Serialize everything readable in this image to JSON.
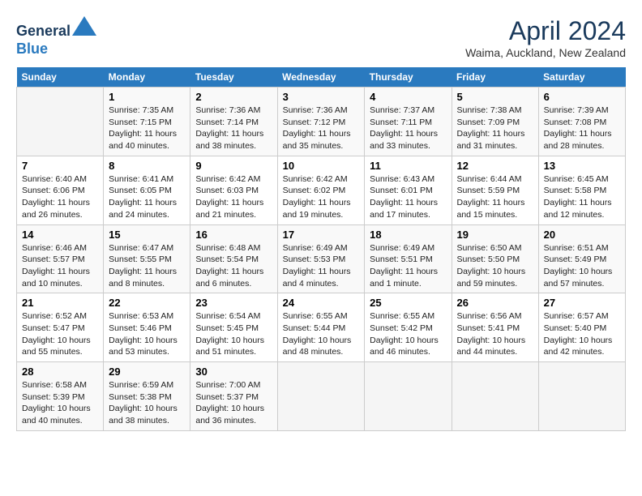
{
  "header": {
    "logo_line1": "General",
    "logo_line2": "Blue",
    "month": "April 2024",
    "location": "Waima, Auckland, New Zealand"
  },
  "weekdays": [
    "Sunday",
    "Monday",
    "Tuesday",
    "Wednesday",
    "Thursday",
    "Friday",
    "Saturday"
  ],
  "weeks": [
    [
      {
        "day": "",
        "info": ""
      },
      {
        "day": "1",
        "info": "Sunrise: 7:35 AM\nSunset: 7:15 PM\nDaylight: 11 hours\nand 40 minutes."
      },
      {
        "day": "2",
        "info": "Sunrise: 7:36 AM\nSunset: 7:14 PM\nDaylight: 11 hours\nand 38 minutes."
      },
      {
        "day": "3",
        "info": "Sunrise: 7:36 AM\nSunset: 7:12 PM\nDaylight: 11 hours\nand 35 minutes."
      },
      {
        "day": "4",
        "info": "Sunrise: 7:37 AM\nSunset: 7:11 PM\nDaylight: 11 hours\nand 33 minutes."
      },
      {
        "day": "5",
        "info": "Sunrise: 7:38 AM\nSunset: 7:09 PM\nDaylight: 11 hours\nand 31 minutes."
      },
      {
        "day": "6",
        "info": "Sunrise: 7:39 AM\nSunset: 7:08 PM\nDaylight: 11 hours\nand 28 minutes."
      }
    ],
    [
      {
        "day": "7",
        "info": "Sunrise: 6:40 AM\nSunset: 6:06 PM\nDaylight: 11 hours\nand 26 minutes."
      },
      {
        "day": "8",
        "info": "Sunrise: 6:41 AM\nSunset: 6:05 PM\nDaylight: 11 hours\nand 24 minutes."
      },
      {
        "day": "9",
        "info": "Sunrise: 6:42 AM\nSunset: 6:03 PM\nDaylight: 11 hours\nand 21 minutes."
      },
      {
        "day": "10",
        "info": "Sunrise: 6:42 AM\nSunset: 6:02 PM\nDaylight: 11 hours\nand 19 minutes."
      },
      {
        "day": "11",
        "info": "Sunrise: 6:43 AM\nSunset: 6:01 PM\nDaylight: 11 hours\nand 17 minutes."
      },
      {
        "day": "12",
        "info": "Sunrise: 6:44 AM\nSunset: 5:59 PM\nDaylight: 11 hours\nand 15 minutes."
      },
      {
        "day": "13",
        "info": "Sunrise: 6:45 AM\nSunset: 5:58 PM\nDaylight: 11 hours\nand 12 minutes."
      }
    ],
    [
      {
        "day": "14",
        "info": "Sunrise: 6:46 AM\nSunset: 5:57 PM\nDaylight: 11 hours\nand 10 minutes."
      },
      {
        "day": "15",
        "info": "Sunrise: 6:47 AM\nSunset: 5:55 PM\nDaylight: 11 hours\nand 8 minutes."
      },
      {
        "day": "16",
        "info": "Sunrise: 6:48 AM\nSunset: 5:54 PM\nDaylight: 11 hours\nand 6 minutes."
      },
      {
        "day": "17",
        "info": "Sunrise: 6:49 AM\nSunset: 5:53 PM\nDaylight: 11 hours\nand 4 minutes."
      },
      {
        "day": "18",
        "info": "Sunrise: 6:49 AM\nSunset: 5:51 PM\nDaylight: 11 hours\nand 1 minute."
      },
      {
        "day": "19",
        "info": "Sunrise: 6:50 AM\nSunset: 5:50 PM\nDaylight: 10 hours\nand 59 minutes."
      },
      {
        "day": "20",
        "info": "Sunrise: 6:51 AM\nSunset: 5:49 PM\nDaylight: 10 hours\nand 57 minutes."
      }
    ],
    [
      {
        "day": "21",
        "info": "Sunrise: 6:52 AM\nSunset: 5:47 PM\nDaylight: 10 hours\nand 55 minutes."
      },
      {
        "day": "22",
        "info": "Sunrise: 6:53 AM\nSunset: 5:46 PM\nDaylight: 10 hours\nand 53 minutes."
      },
      {
        "day": "23",
        "info": "Sunrise: 6:54 AM\nSunset: 5:45 PM\nDaylight: 10 hours\nand 51 minutes."
      },
      {
        "day": "24",
        "info": "Sunrise: 6:55 AM\nSunset: 5:44 PM\nDaylight: 10 hours\nand 48 minutes."
      },
      {
        "day": "25",
        "info": "Sunrise: 6:55 AM\nSunset: 5:42 PM\nDaylight: 10 hours\nand 46 minutes."
      },
      {
        "day": "26",
        "info": "Sunrise: 6:56 AM\nSunset: 5:41 PM\nDaylight: 10 hours\nand 44 minutes."
      },
      {
        "day": "27",
        "info": "Sunrise: 6:57 AM\nSunset: 5:40 PM\nDaylight: 10 hours\nand 42 minutes."
      }
    ],
    [
      {
        "day": "28",
        "info": "Sunrise: 6:58 AM\nSunset: 5:39 PM\nDaylight: 10 hours\nand 40 minutes."
      },
      {
        "day": "29",
        "info": "Sunrise: 6:59 AM\nSunset: 5:38 PM\nDaylight: 10 hours\nand 38 minutes."
      },
      {
        "day": "30",
        "info": "Sunrise: 7:00 AM\nSunset: 5:37 PM\nDaylight: 10 hours\nand 36 minutes."
      },
      {
        "day": "",
        "info": ""
      },
      {
        "day": "",
        "info": ""
      },
      {
        "day": "",
        "info": ""
      },
      {
        "day": "",
        "info": ""
      }
    ]
  ]
}
